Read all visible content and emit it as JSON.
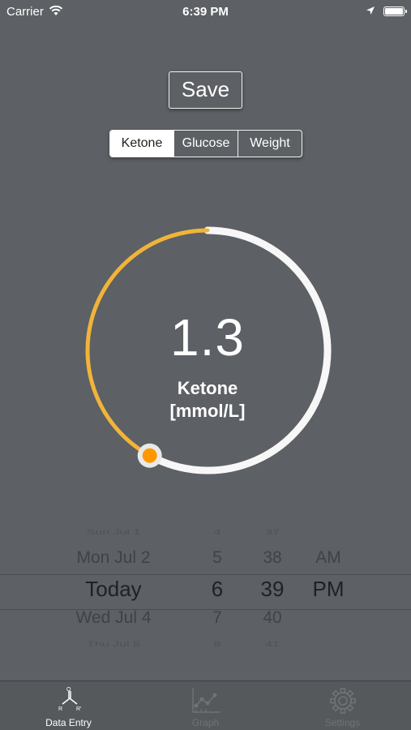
{
  "colors": {
    "background": "#5d6064",
    "arc_track": "#f7f7f7",
    "arc_value": "#f0b43a",
    "knob": "#ff9800"
  },
  "status_bar": {
    "carrier": "Carrier",
    "time": "6:39 PM"
  },
  "save_button": {
    "label": "Save"
  },
  "segments": [
    {
      "label": "Ketone",
      "selected": true
    },
    {
      "label": "Glucose",
      "selected": false
    },
    {
      "label": "Weight",
      "selected": false
    }
  ],
  "dial": {
    "value": "1.3",
    "label_line1": "Ketone",
    "label_line2": "[mmol/L]",
    "fill_fraction": 0.42
  },
  "picker": {
    "rows": [
      {
        "date": "Sun Jul 1",
        "hour": "4",
        "minute": "37",
        "ampm": ""
      },
      {
        "date": "Mon Jul 2",
        "hour": "5",
        "minute": "38",
        "ampm": "AM"
      },
      {
        "date": "Today",
        "hour": "6",
        "minute": "39",
        "ampm": "PM"
      },
      {
        "date": "Wed Jul 4",
        "hour": "7",
        "minute": "40",
        "ampm": ""
      },
      {
        "date": "Thu Jul 5",
        "hour": "8",
        "minute": "41",
        "ampm": ""
      }
    ]
  },
  "tabs": [
    {
      "label": "Data Entry",
      "icon": "molecule-icon",
      "active": true
    },
    {
      "label": "Graph",
      "icon": "graph-icon",
      "active": false
    },
    {
      "label": "Settings",
      "icon": "gear-icon",
      "active": false
    }
  ]
}
